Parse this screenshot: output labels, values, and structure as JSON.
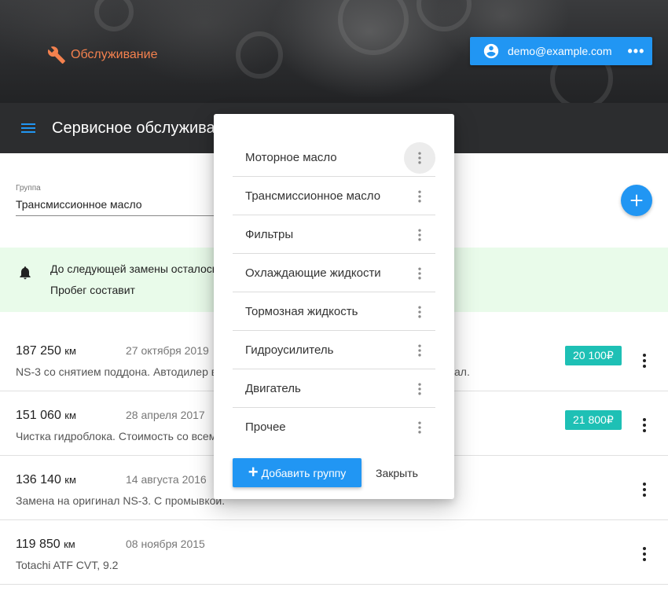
{
  "header": {
    "brand_label": "Обслуживание",
    "brand_icon": "wrench-icon",
    "brand_color": "#f4814e",
    "user_email": "demo@example.com",
    "user_menu": "•••"
  },
  "toolbar": {
    "title": "Сервисное обслуживание"
  },
  "group_select": {
    "label": "Группа",
    "value": "Трансмиссионное масло"
  },
  "notice": {
    "line1": "До следующей замены осталось",
    "line2": "Пробег составит"
  },
  "records": [
    {
      "mileage": "187 250",
      "unit": "км",
      "date": "27 октября 2019",
      "desc": "NS-3 со снятием поддона. Автодилер в",
      "desc_tail": "ал.",
      "price": "20 100₽"
    },
    {
      "mileage": "151 060",
      "unit": "км",
      "date": "28 апреля 2017",
      "desc": "Чистка гидроблока. Стоимость со всем",
      "price": "21 800₽"
    },
    {
      "mileage": "136 140",
      "unit": "км",
      "date": "14 августа 2016",
      "desc": "Замена на оригинал NS-3. С промывкой."
    },
    {
      "mileage": "119 850",
      "unit": "км",
      "date": "08 ноября 2015",
      "desc": "Totachi ATF CVT, 9.2"
    }
  ],
  "dialog": {
    "groups": [
      "Моторное масло",
      "Трансмиссионное масло",
      "Фильтры",
      "Охлаждающие жидкости",
      "Тормозная жидкость",
      "Гидроусилитель",
      "Двигатель",
      "Прочее"
    ],
    "add_label": "Добавить группу",
    "close_label": "Закрыть"
  },
  "colors": {
    "primary": "#2196f3",
    "price_badge": "#1ec0b5",
    "notice_bg": "#e9fbea",
    "toolbar_bg": "#2c2d2f"
  }
}
